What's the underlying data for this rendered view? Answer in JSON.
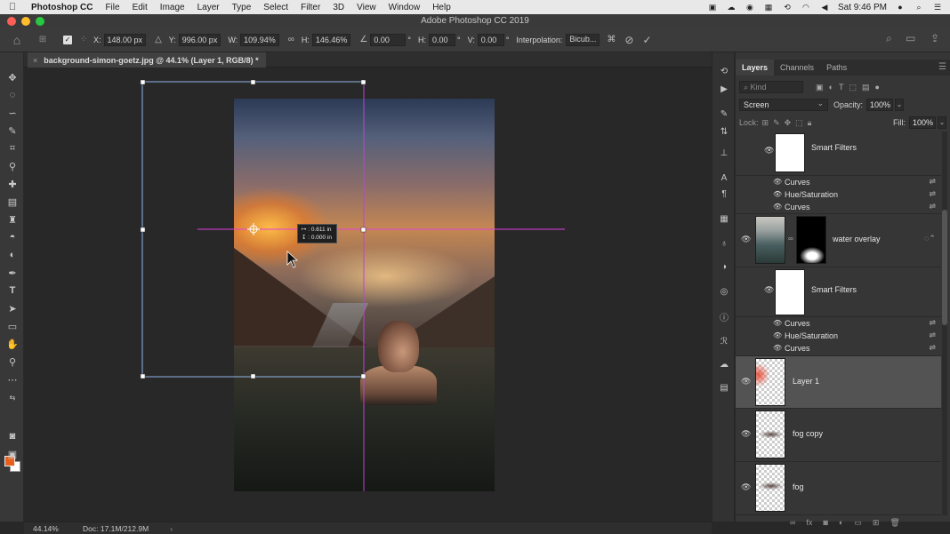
{
  "menubar": {
    "app_name": "Photoshop CC",
    "items": [
      "File",
      "Edit",
      "Image",
      "Layer",
      "Type",
      "Select",
      "Filter",
      "3D",
      "View",
      "Window",
      "Help"
    ],
    "clock": "Sat 9:46 PM"
  },
  "window": {
    "title": "Adobe Photoshop CC 2019"
  },
  "options": {
    "x_label": "X:",
    "x_value": "148.00 px",
    "y_label": "Y:",
    "y_value": "996.00 px",
    "w_label": "W:",
    "w_value": "109.94%",
    "h_label": "H:",
    "h_value": "146.46%",
    "angle_value": "0.00",
    "angle_unit": "°",
    "hskew_label": "H:",
    "hskew_value": "0.00",
    "hskew_unit": "°",
    "vskew_label": "V:",
    "vskew_value": "0.00",
    "vskew_unit": "°",
    "interp_label": "Interpolation:",
    "interp_value": "Bicub..."
  },
  "document": {
    "tab_title": "background-simon-goetz.jpg @ 44.1% (Layer 1, RGB/8) *",
    "close": "×"
  },
  "canvas_info": {
    "line1": "↦ : 0.611 in",
    "line2": "↧ : 0.000 in"
  },
  "status": {
    "zoom": "44.14%",
    "doc": "Doc: 17.1M/212.9M",
    "arrow": "›"
  },
  "layers_panel": {
    "tabs": [
      "Layers",
      "Channels",
      "Paths"
    ],
    "kind_placeholder": "Kind",
    "blend_mode": "Screen",
    "opacity_label": "Opacity:",
    "opacity_value": "100%",
    "lock_label": "Lock:",
    "fill_label": "Fill:",
    "fill_value": "100%",
    "filter_groups": [
      {
        "title": "Smart Filters",
        "filters": [
          "Curves",
          "Hue/Saturation",
          "Curves"
        ]
      },
      {
        "title": "Smart Filters",
        "filters": [
          "Curves",
          "Hue/Saturation",
          "Curves"
        ]
      }
    ],
    "layers": [
      {
        "name": "water overlay"
      },
      {
        "name": "Layer 1",
        "selected": true
      },
      {
        "name": "fog copy"
      },
      {
        "name": "fog"
      }
    ]
  }
}
